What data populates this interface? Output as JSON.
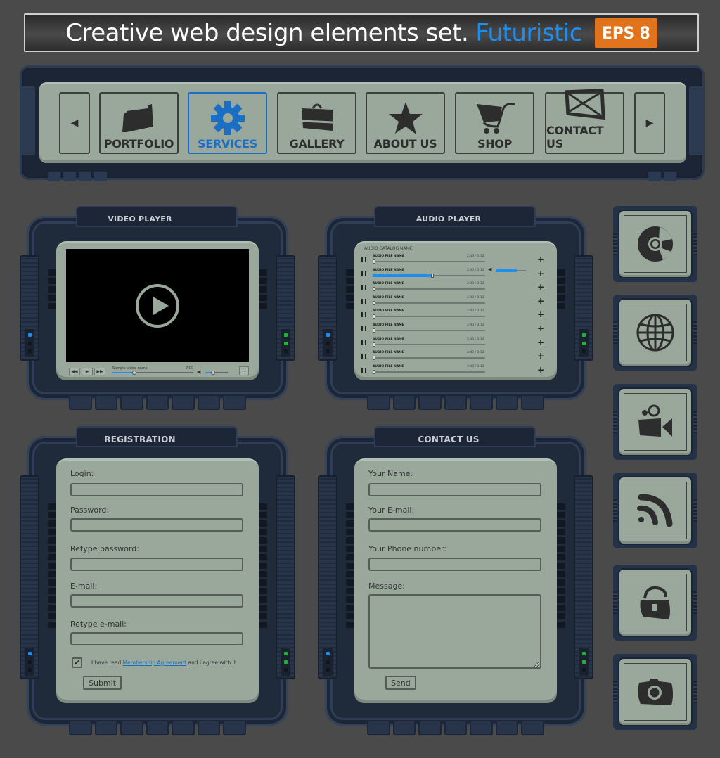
{
  "banner": {
    "title": "Creative web design elements set.",
    "accent": "Futuristic",
    "badge": "EPS 8",
    "colors": {
      "accent": "#1e8ff0",
      "badge": "#e0731c"
    }
  },
  "navigation": {
    "prev_icon": "chevron-left-icon",
    "next_icon": "chevron-right-icon",
    "prev_glyph": "◀",
    "next_glyph": "▶",
    "active_color": "#1a6fc4",
    "items": [
      {
        "label": "PORTFOLIO",
        "icon": "folder-icon",
        "active": false
      },
      {
        "label": "SERVICES",
        "icon": "gear-icon",
        "active": true
      },
      {
        "label": "GALLERY",
        "icon": "bag-icon",
        "active": false
      },
      {
        "label": "ABOUT US",
        "icon": "star-icon",
        "active": false
      },
      {
        "label": "SHOP",
        "icon": "cart-icon",
        "active": false
      },
      {
        "label": "CONTACT US",
        "icon": "envelope-icon",
        "active": false
      }
    ]
  },
  "video_player": {
    "title": "VIDEO PLAYER",
    "video_name": "Sample video name",
    "time": "7:00",
    "progress": 0.27,
    "volume": 0.35,
    "controls": {
      "rewind": "◀◀",
      "play": "▶",
      "forward": "▶▶",
      "fullscreen": "⛶"
    }
  },
  "audio_player": {
    "title": "AUDIO PLAYER",
    "catalog_name": "AUDIO CATALOG NAME",
    "volume": 0.7,
    "plus_glyph": "+",
    "tracks": [
      {
        "name": "AUDIO FILE NAME",
        "time": "2:40 / 3:12",
        "progress": 0.0
      },
      {
        "name": "AUDIO FILE NAME",
        "time": "2:40 / 3:12",
        "progress": 0.52
      },
      {
        "name": "AUDIO FILE NAME",
        "time": "2:40 / 3:12",
        "progress": 0.0
      },
      {
        "name": "AUDIO FILE NAME",
        "time": "2:40 / 3:12",
        "progress": 0.0
      },
      {
        "name": "AUDIO FILE NAME",
        "time": "2:40 / 3:12",
        "progress": 0.0
      },
      {
        "name": "AUDIO FILE NAME",
        "time": "2:40 / 3:12",
        "progress": 0.0
      },
      {
        "name": "AUDIO FILE NAME",
        "time": "2:40 / 3:12",
        "progress": 0.0
      },
      {
        "name": "AUDIO FILE NAME",
        "time": "2:40 / 3:12",
        "progress": 0.0
      },
      {
        "name": "AUDIO FILE NAME",
        "time": "2:40 / 3:12",
        "progress": 0.0
      }
    ]
  },
  "registration": {
    "title": "REGISTRATION",
    "fields": [
      {
        "label": "Login:",
        "value": ""
      },
      {
        "label": "Password:",
        "value": ""
      },
      {
        "label": "Retype password:",
        "value": ""
      },
      {
        "label": "E-mail:",
        "value": ""
      },
      {
        "label": "Retype e-mail:",
        "value": ""
      }
    ],
    "agree_checked": true,
    "check_glyph": "✔",
    "agree_prefix": "I have read",
    "agree_link": "Membership Agreement",
    "agree_suffix": "and i agree with it",
    "submit_label": "Submit"
  },
  "contact": {
    "title": "CONTACT US",
    "fields": [
      {
        "label": "Your Name:",
        "value": ""
      },
      {
        "label": "Your E-mail:",
        "value": ""
      },
      {
        "label": "Your Phone number:",
        "value": ""
      }
    ],
    "message_label": "Message:",
    "message_value": "",
    "send_label": "Send"
  },
  "icon_tiles": [
    {
      "icon": "disc-icon"
    },
    {
      "icon": "globe-icon"
    },
    {
      "icon": "video-camera-icon"
    },
    {
      "icon": "rss-icon"
    },
    {
      "icon": "unlock-icon"
    },
    {
      "icon": "camera-icon"
    }
  ]
}
